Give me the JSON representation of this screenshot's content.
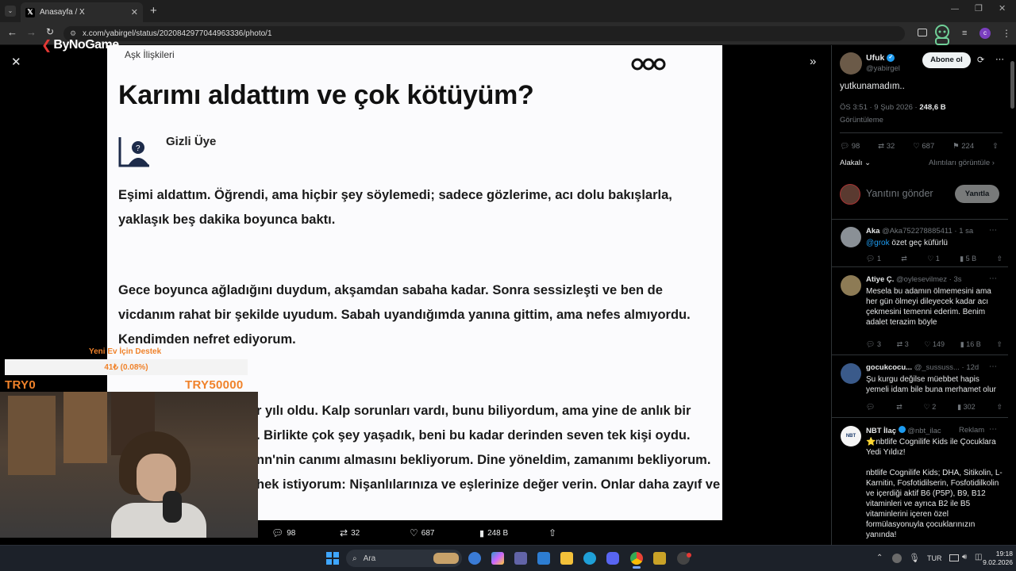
{
  "browser": {
    "tab_title": "Anasayfa / X",
    "url": "x.com/yabirgel/status/2020842977044963336/photo/1"
  },
  "stream_logo": "ByNoGame",
  "photo": {
    "category": "Aşk İlişkileri",
    "title": "Karımı aldattım ve çok kötüyüm?",
    "username": "Gizli Üye",
    "paragraph1": [
      "Eşimi aldattım. Öğrendi, ama hiçbir şey söylemedi; sadece gözlerime, acı dolu bakışlarla,",
      "yaklaşık beş dakika boyunca baktı."
    ],
    "paragraph2": [
      "Gece boyunca ağladığını duydum, akşamdan sabaha kadar. Sonra sessizleşti ve ben de",
      "vicdanım rahat bir şekilde uyudum. Sabah uyandığımda yanına gittim, ama nefes almıyordu.",
      "Kendimden nefret ediyorum."
    ],
    "paragraph3": [
      "r yılı oldu. Kalp sorunları vardı, bunu biliyordum, ama yine de anlık bir",
      ". Birlikte çok şey yaşadık, beni bu kadar derinden seven tek kişi oydu.",
      "nn'nin canımı almasını bekliyorum. Dine yöneldim, zamanımı bekliyorum.",
      "hek istiyorum: Nişanlılarınıza ve eşlerinize değer verin. Onlar daha zayıf ve"
    ]
  },
  "media_actions": {
    "replies": "98",
    "reposts": "32",
    "likes": "687",
    "views": "248 B"
  },
  "tweet": {
    "name": "Ufuk",
    "handle": "@yabirgel",
    "follow_label": "Abone ol",
    "text": "yutkunamadım..",
    "time": "ÖS 3:51 · 9 Şub 2026 ·",
    "views_count": "248,6 B",
    "views_label": "Görüntüleme",
    "replies": "98",
    "reposts": "32",
    "likes": "687",
    "bookmarks": "224",
    "sort_label": "Alakalı",
    "quotes_link": "Alıntıları görüntüle",
    "reply_placeholder": "Yanıtını gönder",
    "reply_button": "Yanıtla"
  },
  "replies": [
    {
      "name": "Aka",
      "handle": "@Aka752278885411 · 1 sa",
      "mention": "@grok",
      "text": " özet geç küfürlü",
      "r": "1",
      "rt": "",
      "l": "1",
      "v": "5 B"
    },
    {
      "name": "Atiye Ç.",
      "handle": "@oylesevilmez · 3s",
      "text": "Mesela bu adamın ölmemesini ama her gün ölmeyi dileyecek kadar acı çekmesini temenni ederim. Benim adalet terazim böyle",
      "r": "3",
      "rt": "3",
      "l": "149",
      "v": "16 B"
    },
    {
      "name": "gocukcocu...",
      "handle": "@_sussuss... · 12d",
      "text": "Şu kurgu değilse müebbet hapis yemeli idam bile buna merhamet olur",
      "r": "",
      "rt": "",
      "l": "2",
      "v": "302"
    },
    {
      "name": "NBT İlaç",
      "handle": "@nbt_ilac",
      "ad_label": "Reklam",
      "text1": "⭐nbtlife Cognilife Kids ile Çocuklara Yedi Yıldız!",
      "text2": "nbtlife Cognilife Kids; DHA, Sitikolin, L-Karnitin, Fosfotidilserin, Fosfotidilkolin ve içerdiği aktif B6 (P5P), B9, B12 vitaminleri ve ayrıca B2 ile B5 vitaminlerini içeren özel formülasyonuyla çocuklarınızın yanında!"
    }
  ],
  "overlay": {
    "donation_title": "Yeni Ev İçin Destek",
    "donation_progress": "41₺ (0.08%)",
    "donation_fraction": 0.0008,
    "min_label": "TRY0",
    "max_label": "TRY50000"
  },
  "taskbar": {
    "search_placeholder": "Ara",
    "lang": "TUR",
    "time": "19:18",
    "date": "9.02.2026"
  }
}
